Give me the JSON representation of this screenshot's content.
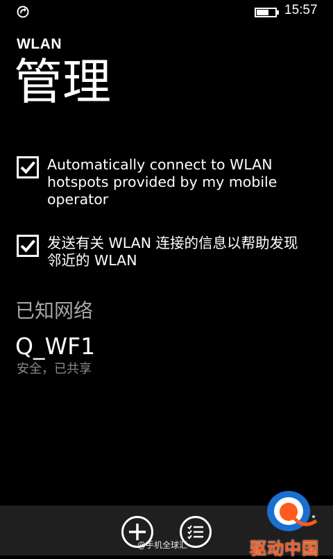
{
  "status_bar": {
    "time": "15:57",
    "left_icon": "data-sync-icon",
    "battery_icon": "battery-icon"
  },
  "header": {
    "app_title": "WLAN",
    "page_title": "管理"
  },
  "settings": {
    "auto_connect": {
      "label": "Automatically connect to WLAN hotspots provided by my mobile operator",
      "checked": true
    },
    "send_info": {
      "label": "发送有关 WLAN 连接的信息以帮助发现邻近的 WLAN",
      "checked": true
    }
  },
  "known_networks": {
    "header": "已知网络",
    "items": [
      {
        "name": "Q_WF1",
        "status": "安全，已共享"
      }
    ]
  },
  "app_bar": {
    "add_icon": "add-icon",
    "list_icon": "list-icon"
  },
  "watermark": {
    "text": "@手机全球汇",
    "logo_text": "驱动中国"
  },
  "colors": {
    "background": "#000000",
    "secondary_text": "#a6a6a6",
    "app_bar": "#1f1f1f",
    "logo_accent": "#ff5a1f"
  }
}
